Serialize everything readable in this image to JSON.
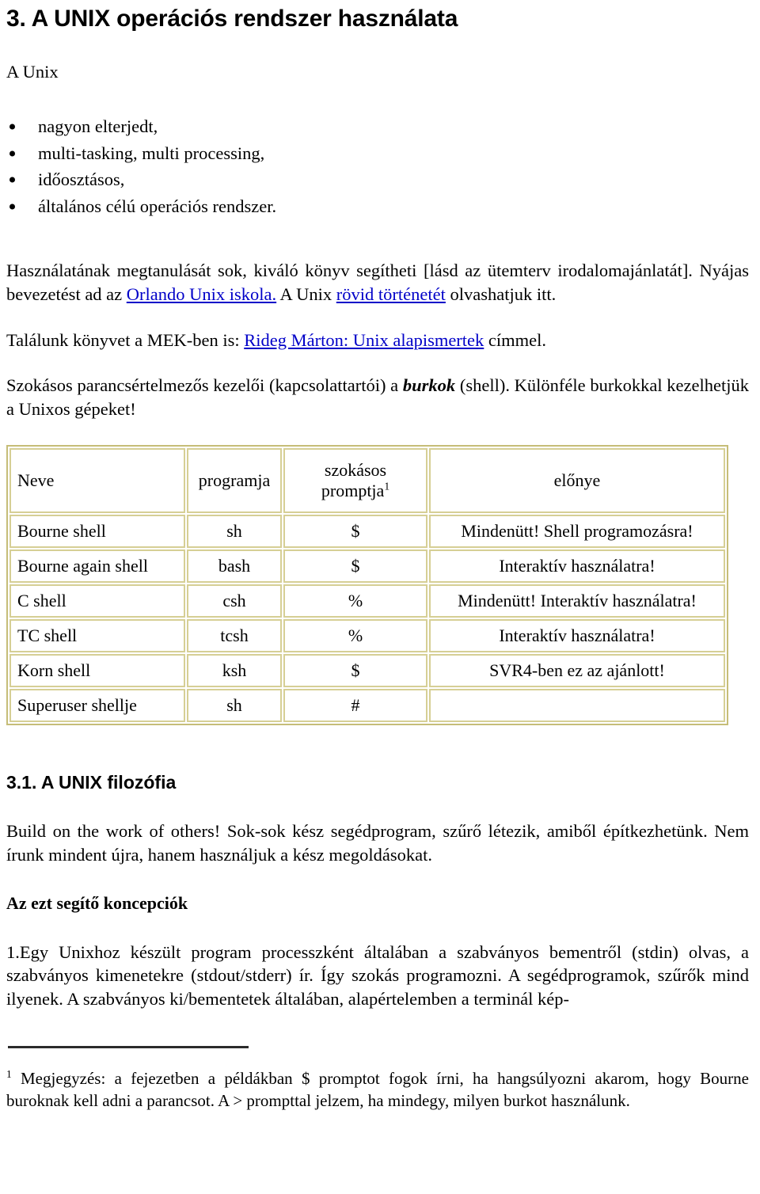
{
  "document": {
    "chapter_heading": "3. A UNIX operációs rendszer használata",
    "lead": "A Unix",
    "bullets": [
      "nagyon elterjedt,",
      "multi-tasking, multi processing,",
      "időosztásos,",
      "általános célú operációs rendszer."
    ],
    "paragraph_books": {
      "part1": "Használatának megtanulását sok, kiváló könyv segítheti [lásd az ütemterv irodalomajánlatát]. Nyájas bevezetést ad az ",
      "link1": "Orlando Unix iskola.",
      "part2": " A Unix ",
      "link2": "rövid történetét",
      "part3": " olvashatjuk itt."
    },
    "paragraph_mek": {
      "part1": "Találunk könyvet a MEK-ben is: ",
      "link1": "Rideg Márton: Unix alapismertek",
      "part2": " címmel."
    },
    "paragraph_shells": {
      "part1": "Szokásos parancsértelmezős kezelői (kapcsolattartói) a ",
      "emphasis": "burkok",
      "part2": " (shell). Különféle burkokkal kezelhetjük a Unixos gépeket!"
    },
    "shell_table": {
      "headers": [
        "Neve",
        "programja",
        "szokásos promptja",
        "előnye"
      ],
      "header_promptja_line1": "szokásos",
      "header_promptja_line2": "promptja",
      "header_footnote_marker": "1",
      "rows": [
        {
          "name": "Bourne shell",
          "program": "sh",
          "prompt": "$",
          "advantage": "Mindenütt! Shell programozásra!"
        },
        {
          "name": "Bourne again shell",
          "program": "bash",
          "prompt": "$",
          "advantage": "Interaktív használatra!"
        },
        {
          "name": "C shell",
          "program": "csh",
          "prompt": "%",
          "advantage": "Mindenütt! Interaktív használatra!"
        },
        {
          "name": "TC shell",
          "program": "tcsh",
          "prompt": "%",
          "advantage": "Interaktív használatra!"
        },
        {
          "name": "Korn shell",
          "program": "ksh",
          "prompt": "$",
          "advantage": "SVR4-ben ez az ajánlott!"
        },
        {
          "name": "Superuser shellje",
          "program": "sh",
          "prompt": "#",
          "advantage": ""
        }
      ]
    },
    "section_heading": "3.1. A UNIX filozófia",
    "paragraph_philosophy": "Build on the work of others! Sok-sok kész segédprogram, szűrő létezik, amiből építkezhetünk. Nem írunk mindent újra, hanem használjuk a kész megoldásokat.",
    "subheading_concepts": "Az ezt segítő koncepciók",
    "paragraph_concept1": "1.Egy Unixhoz készült program processzként általában a szabványos bementről (stdin) olvas, a szabványos kimenetekre (stdout/stderr) ír. Így szokás programozni. A segédprogramok, szűrők mind ilyenek. A szabványos ki/bementetek általában, alapértelemben a terminál kép-",
    "footnote": {
      "marker": "1",
      "text": " Megjegyzés: a fejezetben a példákban $ promptot fogok írni, ha hangsúlyozni akarom, hogy Bourne buroknak kell adni a parancsot. A > prompttal jelzem, ha mindegy, milyen burkot használunk."
    },
    "colors": {
      "link": "#0000c8",
      "table_border_outer": "#c6bd78",
      "table_border_inner": "#d6cf95",
      "text": "#000000",
      "footnote_rule": "#2b2b2b"
    }
  }
}
